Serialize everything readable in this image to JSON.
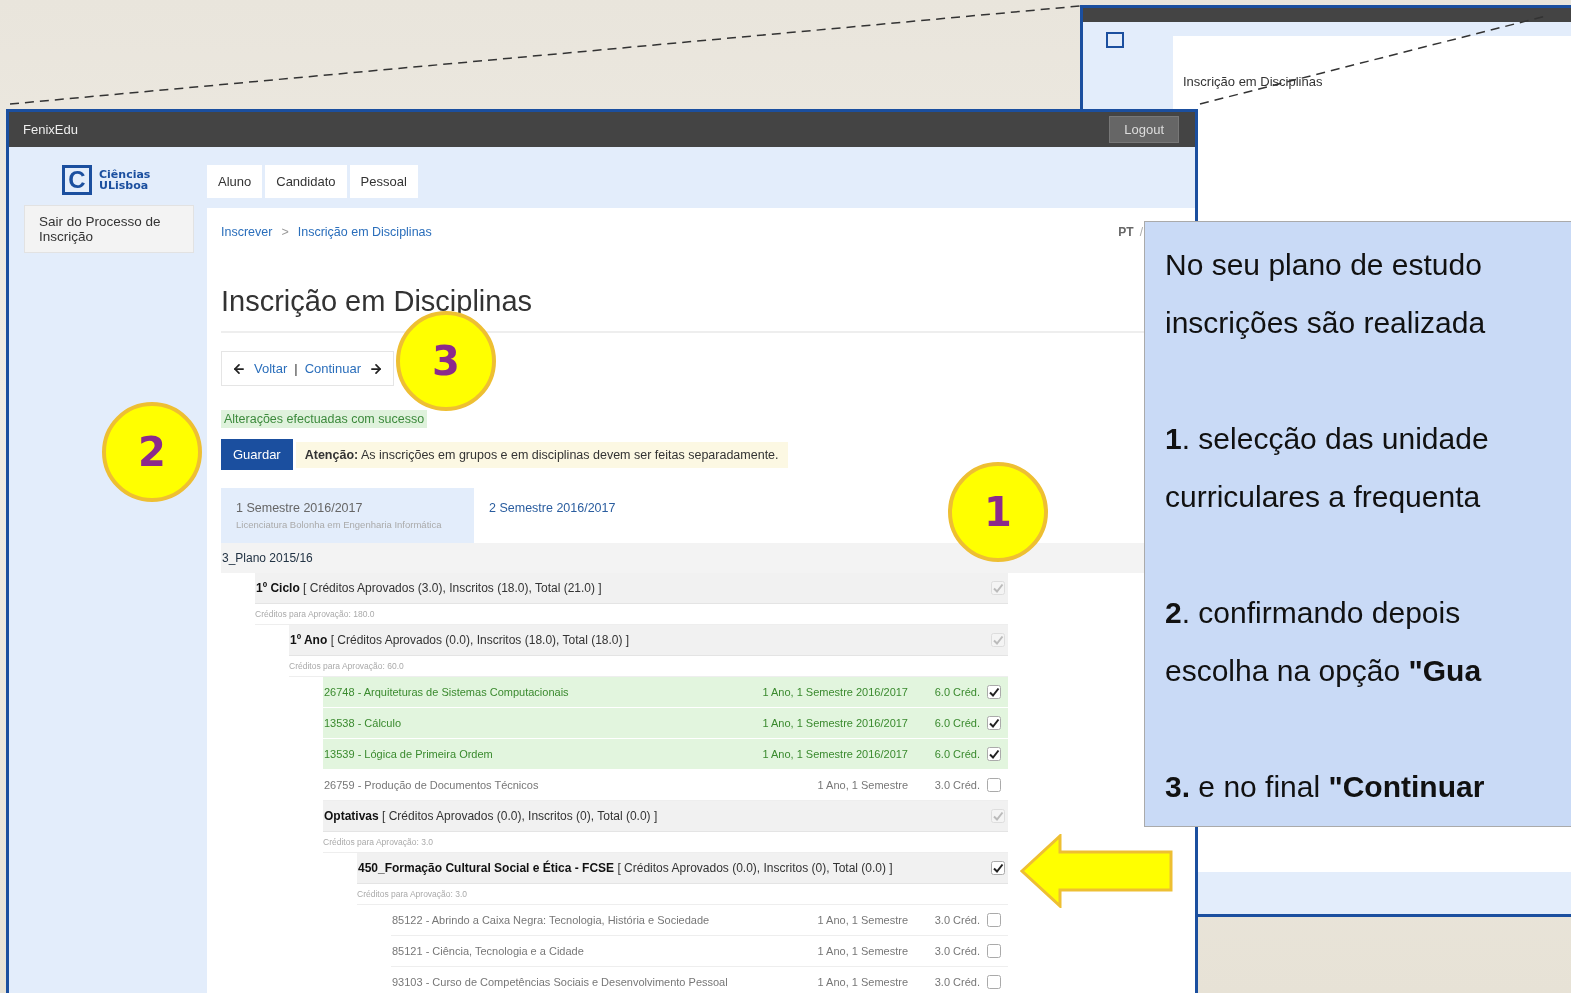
{
  "back_window": {
    "heading": "Inscrição em Disciplinas"
  },
  "window": {
    "title": "FenixEdu",
    "logout": "Logout"
  },
  "logo": {
    "mark": "C",
    "line1": "Ciências",
    "line2": "ULisboa"
  },
  "nav_tabs": [
    "Aluno",
    "Candidato",
    "Pessoal"
  ],
  "sidebar": {
    "items": [
      "Sair do Processo de Inscrição"
    ]
  },
  "breadcrumb": {
    "items": [
      "Inscrever",
      "Inscrição em Disciplinas"
    ],
    "separator": ">"
  },
  "languages": {
    "items": [
      {
        "label": "PT",
        "selected": true
      }
    ],
    "separator": "/"
  },
  "heading": "Inscrição em Disciplinas",
  "step_nav": {
    "back": "Voltar",
    "separator": "|",
    "next": "Continuar"
  },
  "success_message": "Alterações efectuadas com sucesso",
  "save_button": "Guardar",
  "warning": "**Atenção:** As inscrições em grupos e em disciplinas devem ser feitas separadamente.",
  "semester_tabs": [
    {
      "label": "1 Semestre 2016/2017",
      "subtitle": "Licenciatura Bolonha em Engenharia Informática",
      "selected": true
    },
    {
      "label": "2 Semestre 2016/2017",
      "selected": false
    }
  ],
  "plan": {
    "label": "3_Plano 2015/16",
    "children": [
      {
        "kind": "group",
        "name": "1º Ciclo",
        "summary": "[ Créditos Aprovados (3.0), Inscritos (18.0), Total (21.0) ]",
        "checked": true,
        "disabled": true,
        "requirement": "Créditos para Aprovação: 180.0",
        "children": [
          {
            "kind": "group",
            "name": "1º Ano",
            "summary": "[ Créditos Aprovados (0.0), Inscritos (18.0), Total (18.0) ]",
            "checked": true,
            "disabled": true,
            "requirement": "Créditos para Aprovação: 60.0",
            "children": [
              {
                "kind": "course",
                "name": "26748 - Arquiteturas de Sistemas Computacionais",
                "period": "1 Ano, 1 Semestre 2016/2017",
                "credits": "6.0 Créd.",
                "checked": true
              },
              {
                "kind": "course",
                "name": "13538 - Cálculo",
                "period": "1 Ano, 1 Semestre 2016/2017",
                "credits": "6.0 Créd.",
                "checked": true
              },
              {
                "kind": "course",
                "name": "13539 - Lógica de Primeira Ordem",
                "period": "1 Ano, 1 Semestre 2016/2017",
                "credits": "6.0 Créd.",
                "checked": true
              },
              {
                "kind": "course",
                "name": "26759 - Produção de Documentos Técnicos",
                "period": "1 Ano, 1 Semestre",
                "credits": "3.0 Créd.",
                "checked": false
              },
              {
                "kind": "group",
                "name": "Optativas",
                "summary": "[ Créditos Aprovados (0.0), Inscritos (0), Total (0.0) ]",
                "checked": true,
                "disabled": true,
                "requirement": "Créditos para Aprovação: 3.0",
                "children": [
                  {
                    "kind": "group",
                    "name": "450_Formação Cultural Social e Ética - FCSE",
                    "summary": "[ Créditos Aprovados (0.0), Inscritos (0), Total (0.0) ]",
                    "checked": true,
                    "disabled": false,
                    "requirement": "Créditos para Aprovação: 3.0",
                    "children": [
                      {
                        "kind": "course",
                        "name": "85122 - Abrindo a Caixa Negra: Tecnologia, História e Sociedade",
                        "period": "1 Ano, 1 Semestre",
                        "credits": "3.0 Créd.",
                        "checked": false
                      },
                      {
                        "kind": "course",
                        "name": "85121 - Ciência, Tecnologia e a Cidade",
                        "period": "1 Ano, 1 Semestre",
                        "credits": "3.0 Créd.",
                        "checked": false
                      },
                      {
                        "kind": "course",
                        "name": "93103 - Curso de Competências Sociais e Desenvolvimento Pessoal",
                        "period": "1 Ano, 1 Semestre",
                        "credits": "3.0 Créd.",
                        "checked": false
                      }
                    ]
                  }
                ]
              }
            ]
          }
        ]
      }
    ]
  },
  "callout": {
    "paragraphs": [
      [
        "No seu plano de estudo",
        "inscrições são realizada"
      ],
      [
        "**1**. selecção das unidade",
        "curriculares a frequenta"
      ],
      [
        "**2**. confirmando depois",
        "escolha na opção **\"Gua**"
      ],
      [
        "**3.** e no final **\"Continuar**"
      ]
    ]
  },
  "annotations": [
    {
      "number": "1"
    },
    {
      "number": "2"
    },
    {
      "number": "3"
    }
  ]
}
